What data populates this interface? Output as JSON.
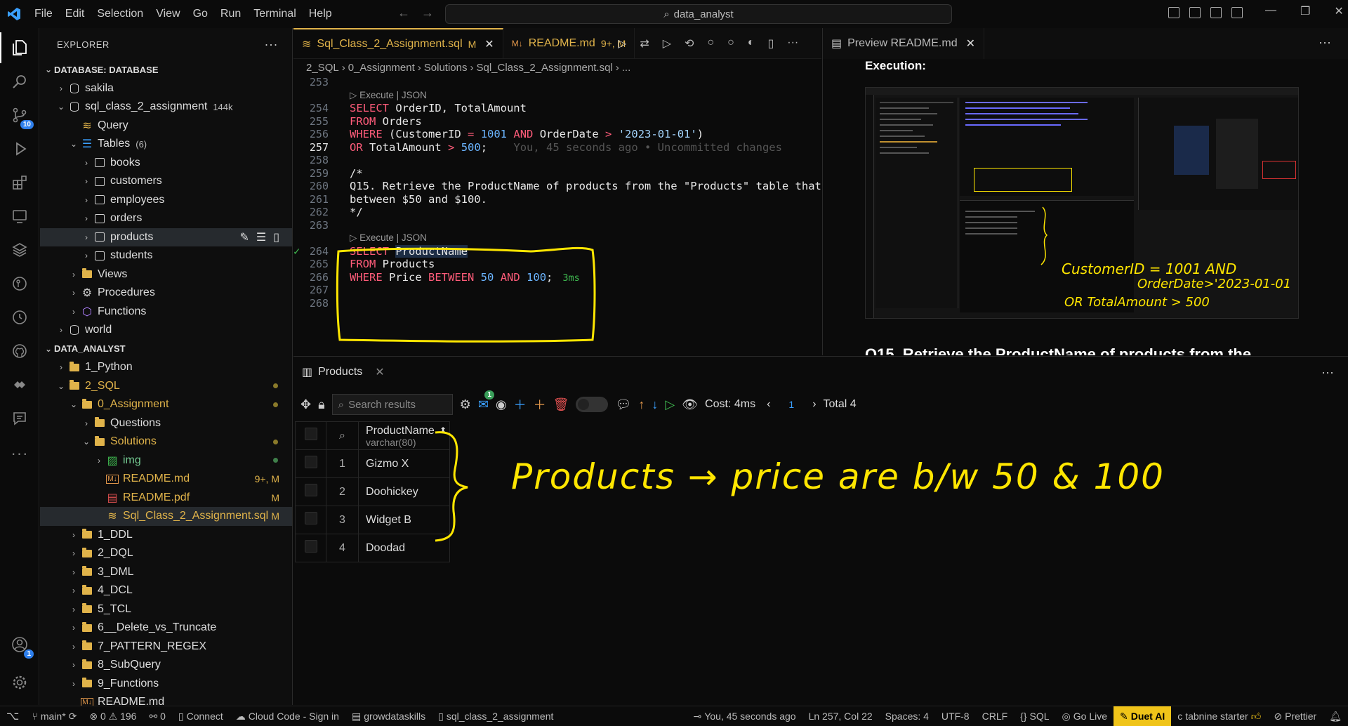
{
  "titlebar": {
    "menus": [
      "File",
      "Edit",
      "Selection",
      "View",
      "Go",
      "Run",
      "Terminal",
      "Help"
    ],
    "search": "data_analyst"
  },
  "activity": {
    "source_control_badge": "10",
    "accounts_badge": "1"
  },
  "explorer": {
    "title": "EXPLORER",
    "db_section": "DATABASE: DATABASE",
    "db_rows": [
      {
        "label": "sakila",
        "type": "db",
        "indent": 1,
        "chev": "›"
      },
      {
        "label": "sql_class_2_assignment",
        "extra": "144k",
        "type": "db",
        "indent": 1,
        "chev": "⌄"
      },
      {
        "label": "Query",
        "type": "query",
        "indent": 2,
        "chev": ""
      },
      {
        "label": "Tables",
        "extra": "(6)",
        "type": "tables",
        "indent": 2,
        "chev": "⌄"
      },
      {
        "label": "books",
        "type": "table",
        "indent": 3,
        "chev": "›"
      },
      {
        "label": "customers",
        "type": "table",
        "indent": 3,
        "chev": "›"
      },
      {
        "label": "employees",
        "type": "table",
        "indent": 3,
        "chev": "›"
      },
      {
        "label": "orders",
        "type": "table",
        "indent": 3,
        "chev": "›"
      },
      {
        "label": "products",
        "type": "table",
        "indent": 3,
        "chev": "›",
        "selected": true
      },
      {
        "label": "students",
        "type": "table",
        "indent": 3,
        "chev": "›"
      },
      {
        "label": "Views",
        "type": "folder",
        "indent": 2,
        "chev": "›"
      },
      {
        "label": "Procedures",
        "type": "gear",
        "indent": 2,
        "chev": "›"
      },
      {
        "label": "Functions",
        "type": "cube",
        "indent": 2,
        "chev": "›"
      },
      {
        "label": "world",
        "type": "db",
        "indent": 1,
        "chev": "›"
      }
    ],
    "workspace_section": "DATA_ANALYST",
    "ws_rows": [
      {
        "label": "1_Python",
        "type": "folder",
        "indent": 1,
        "chev": "›"
      },
      {
        "label": "2_SQL",
        "type": "folder",
        "indent": 1,
        "chev": "⌄",
        "color": "#e0b34a",
        "dot": "#8a7a2a"
      },
      {
        "label": "0_Assignment",
        "type": "folder",
        "indent": 2,
        "chev": "⌄",
        "color": "#e0b34a",
        "dot": "#8a7a2a"
      },
      {
        "label": "Questions",
        "type": "folder",
        "indent": 3,
        "chev": "›"
      },
      {
        "label": "Solutions",
        "type": "folder",
        "indent": 3,
        "chev": "⌄",
        "color": "#e0b34a",
        "dot": "#8a7a2a"
      },
      {
        "label": "img",
        "type": "img",
        "indent": 4,
        "chev": "›",
        "color": "#73c991",
        "dot": "#3f7f4a"
      },
      {
        "label": "README.md",
        "type": "md",
        "indent": 4,
        "chev": "",
        "color": "#e0b34a",
        "status": "9+, M"
      },
      {
        "label": "README.pdf",
        "type": "pdf",
        "indent": 4,
        "chev": "",
        "color": "#e0b34a",
        "status": "M"
      },
      {
        "label": "Sql_Class_2_Assignment.sql",
        "type": "sql",
        "indent": 4,
        "chev": "",
        "color": "#e0b34a",
        "status": "M",
        "selected": true
      },
      {
        "label": "1_DDL",
        "type": "folder",
        "indent": 2,
        "chev": "›"
      },
      {
        "label": "2_DQL",
        "type": "folder",
        "indent": 2,
        "chev": "›"
      },
      {
        "label": "3_DML",
        "type": "folder",
        "indent": 2,
        "chev": "›"
      },
      {
        "label": "4_DCL",
        "type": "folder",
        "indent": 2,
        "chev": "›"
      },
      {
        "label": "5_TCL",
        "type": "folder",
        "indent": 2,
        "chev": "›"
      },
      {
        "label": "6__Delete_vs_Truncate",
        "type": "folder",
        "indent": 2,
        "chev": "›"
      },
      {
        "label": "7_PATTERN_REGEX",
        "type": "folder",
        "indent": 2,
        "chev": "›"
      },
      {
        "label": "8_SubQuery",
        "type": "folder",
        "indent": 2,
        "chev": "›"
      },
      {
        "label": "9_Functions",
        "type": "folder",
        "indent": 2,
        "chev": "›"
      },
      {
        "label": "README.md",
        "type": "md",
        "indent": 2,
        "chev": ""
      }
    ]
  },
  "tabs": {
    "sql_tab": "Sql_Class_2_Assignment.sql",
    "sql_mod": "M",
    "readme_tab": "README.md",
    "readme_mod": "9+, M",
    "preview_tab": "Preview README.md"
  },
  "breadcrumb": [
    "2_SQL",
    "0_Assignment",
    "Solutions",
    "Sql_Class_2_Assignment.sql",
    "..."
  ],
  "code": {
    "lines": [
      {
        "n": "253",
        "html": ""
      },
      {
        "n": "",
        "html": "▷ Execute | JSON",
        "lens": true
      },
      {
        "n": "254",
        "html": "<span class='kw'>SELECT</span> OrderID, TotalAmount"
      },
      {
        "n": "255",
        "html": "<span class='kw'>FROM</span> Orders"
      },
      {
        "n": "256",
        "html": "<span class='kw'>WHERE</span> (CustomerID <span class='kw'>=</span> <span class='num'>1001</span> <span class='kw'>AND</span> OrderDate <span class='kw'>&gt;</span> <span class='str'>'2023-01-01'</span>)"
      },
      {
        "n": "257",
        "html": "<span class='kw'>OR</span> TotalAmount <span class='kw'>&gt;</span> <span class='num'>500</span>;    <span class='ghost'>You, 45 seconds ago • Uncommitted changes</span>",
        "cur": true
      },
      {
        "n": "258",
        "html": ""
      },
      {
        "n": "259",
        "html": "/*"
      },
      {
        "n": "260",
        "html": "Q15. Retrieve the ProductName of products from the \"Products\" table that"
      },
      {
        "n": "261",
        "html": "between $50 and $100."
      },
      {
        "n": "262",
        "html": "*/"
      },
      {
        "n": "263",
        "html": ""
      },
      {
        "n": "",
        "html": "▷ Execute | JSON",
        "lens": true
      },
      {
        "n": "264",
        "html": "<span class='kw'>SELECT</span> <span class='hl'>ProductName</span>"
      },
      {
        "n": "265",
        "html": "<span class='kw'>FROM</span> Products"
      },
      {
        "n": "266",
        "html": "<span class='kw'>WHERE</span> Price <span class='kw'>BETWEEN</span> <span class='num'>50</span> <span class='kw'>AND</span> <span class='num'>100</span>;<span class='timing'>3ms</span>"
      },
      {
        "n": "267",
        "html": ""
      },
      {
        "n": "268",
        "html": ""
      }
    ]
  },
  "preview": {
    "heading": "Execution:",
    "q15": "Q15. Retrieve the ProductName of products from the"
  },
  "results": {
    "tab": "Products",
    "search_placeholder": "Search results",
    "mail_badge": "1",
    "cost": "Cost: 4ms",
    "page": "1",
    "total": "Total 4",
    "column": "ProductName",
    "column_type": "varchar(80)",
    "rows": [
      {
        "n": "1",
        "name": "Gizmo X"
      },
      {
        "n": "2",
        "name": "Doohickey"
      },
      {
        "n": "3",
        "name": "Widget B"
      },
      {
        "n": "4",
        "name": "Doodad"
      }
    ]
  },
  "annotation": {
    "note": "Products → price are b/w 50 & 100"
  },
  "statusbar": {
    "branch": "main*",
    "problems": "⊗ 0 ⚠ 196",
    "ports": "⚯ 0",
    "connect": "Connect",
    "cloud": "Cloud Code - Sign in",
    "workspace": "growdataskills",
    "db": "sql_class_2_assignment",
    "blame": "You, 45 seconds ago",
    "position": "Ln 257, Col 22",
    "spaces": "Spaces: 4",
    "encoding": "UTF-8",
    "eol": "CRLF",
    "lang": "SQL",
    "golive": "Go Live",
    "duet": "Duet AI",
    "tabnine": "tabnine starter",
    "prettier": "Prettier"
  }
}
